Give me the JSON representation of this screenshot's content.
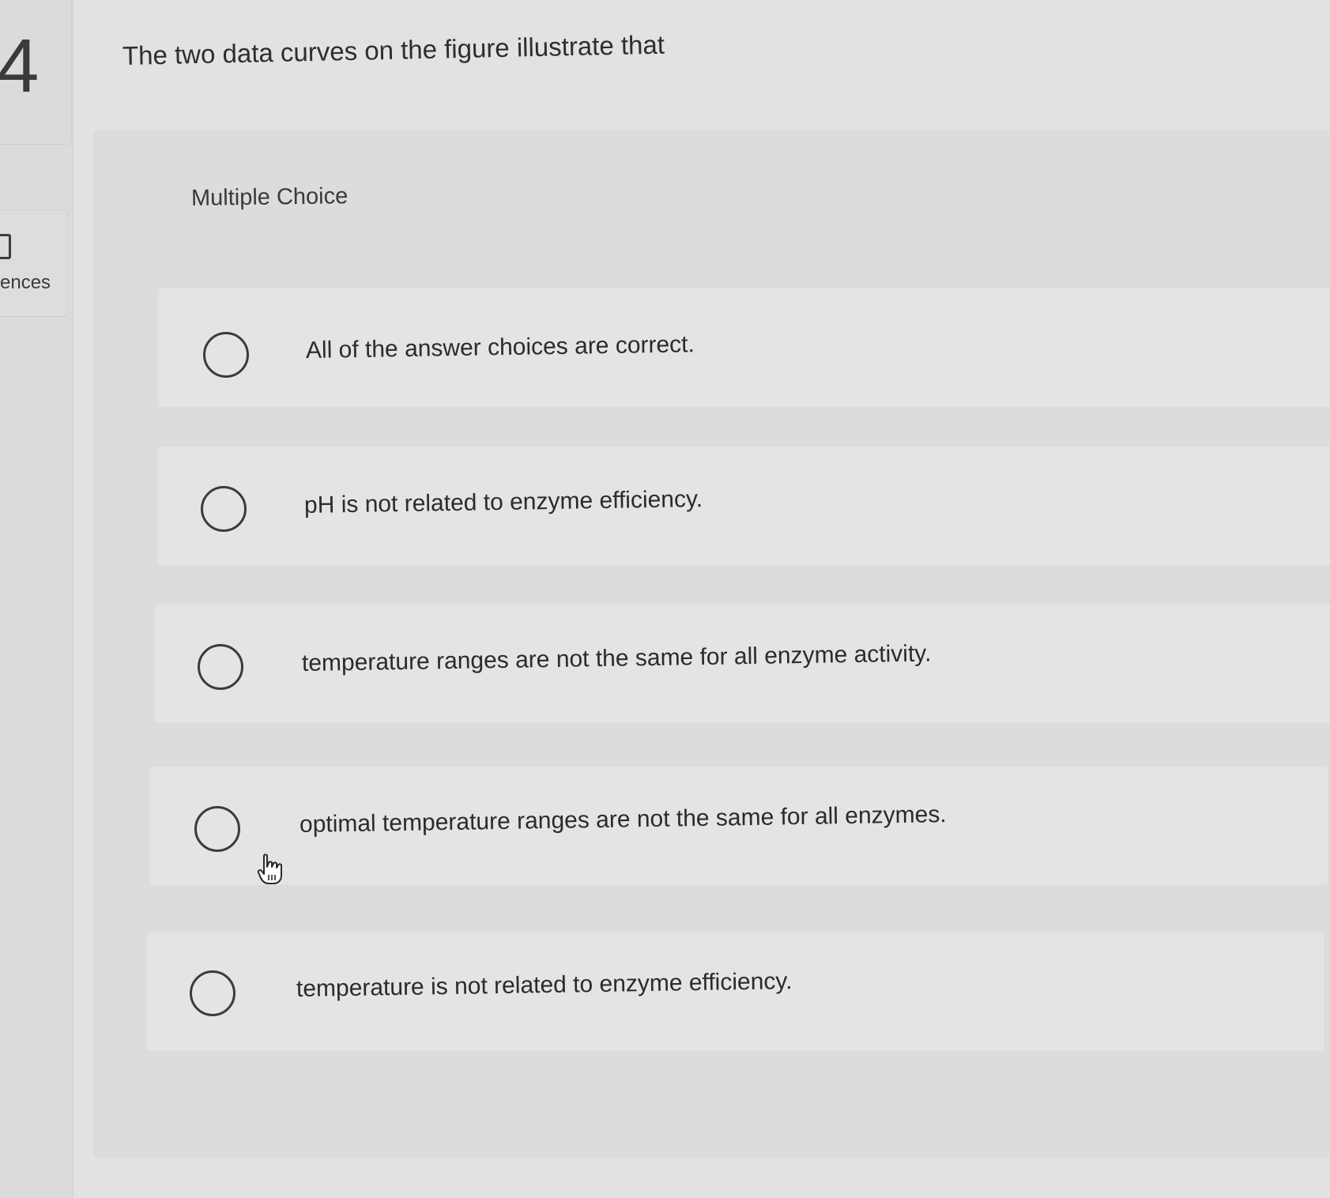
{
  "sidebar": {
    "question_number": "4",
    "references_label": "ences"
  },
  "question": {
    "prompt": "The two data curves on the figure illustrate that",
    "type_label": "Multiple Choice"
  },
  "choices": [
    {
      "label": "All of the answer choices are correct."
    },
    {
      "label": "pH is not related to enzyme efficiency."
    },
    {
      "label": "temperature ranges are not the same for all enzyme activity."
    },
    {
      "label": "optimal temperature ranges are not the same for all enzymes."
    },
    {
      "label": "temperature is not related to enzyme efficiency."
    }
  ],
  "icons": {
    "radio": "radio-unselected-icon",
    "pointer": "hand-pointer-icon",
    "references": "book-icon"
  }
}
